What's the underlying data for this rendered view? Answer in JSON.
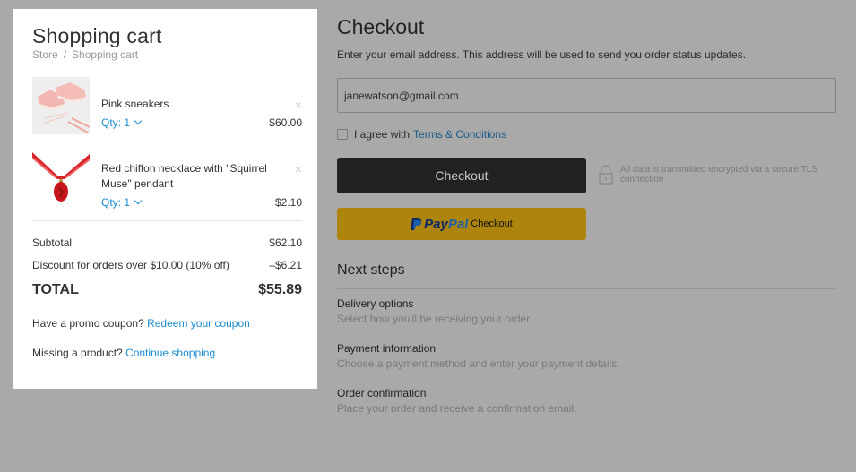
{
  "cart": {
    "title": "Shopping cart",
    "breadcrumb": [
      "Store",
      "Shopping cart"
    ],
    "breadcrumb_separator": "/",
    "items": [
      {
        "name": "Pink sneakers",
        "qty_label": "Qty: 1",
        "price": "$60.00",
        "remove_icon": "×",
        "image": "pink-sneakers"
      },
      {
        "name": "Red chiffon necklace with \"Squirrel Muse\" pendant",
        "qty_label": "Qty: 1",
        "price": "$2.10",
        "remove_icon": "×",
        "image": "red-necklace"
      }
    ],
    "subtotal_label": "Subtotal",
    "subtotal_value": "$62.10",
    "discount_label": "Discount for orders over $10.00 (10% off)",
    "discount_value": "–$6.21",
    "total_label": "TOTAL",
    "total_value": "$55.89",
    "promo_text": "Have a promo coupon?",
    "promo_link": "Redeem your coupon",
    "missing_text": "Missing a product?",
    "missing_link": "Continue shopping"
  },
  "checkout": {
    "title": "Checkout",
    "description": "Enter your email address. This address will be used to send you order status updates.",
    "email_value": "janewatson@gmail.com",
    "agree_text": "I agree with",
    "agree_link": "Terms & Conditions",
    "checkout_button": "Checkout",
    "secure_text": "All data is transmitted encrypted via a secure TLS connection",
    "paypal_pay": "Pay",
    "paypal_pal": "Pal",
    "paypal_checkout": "Checkout"
  },
  "next_steps": {
    "title": "Next steps",
    "steps": [
      {
        "title": "Delivery options",
        "desc": "Select how you'll be receiving your order."
      },
      {
        "title": "Payment information",
        "desc": "Choose a payment method and enter your payment details."
      },
      {
        "title": "Order confirmation",
        "desc": "Place your order and receive a confirmation email."
      }
    ]
  },
  "colors": {
    "overlay_bg": "#a9a9a9",
    "link_blue": "#1a8bd0",
    "checkout_btn": "#222222",
    "paypal_btn": "#ad840c"
  }
}
